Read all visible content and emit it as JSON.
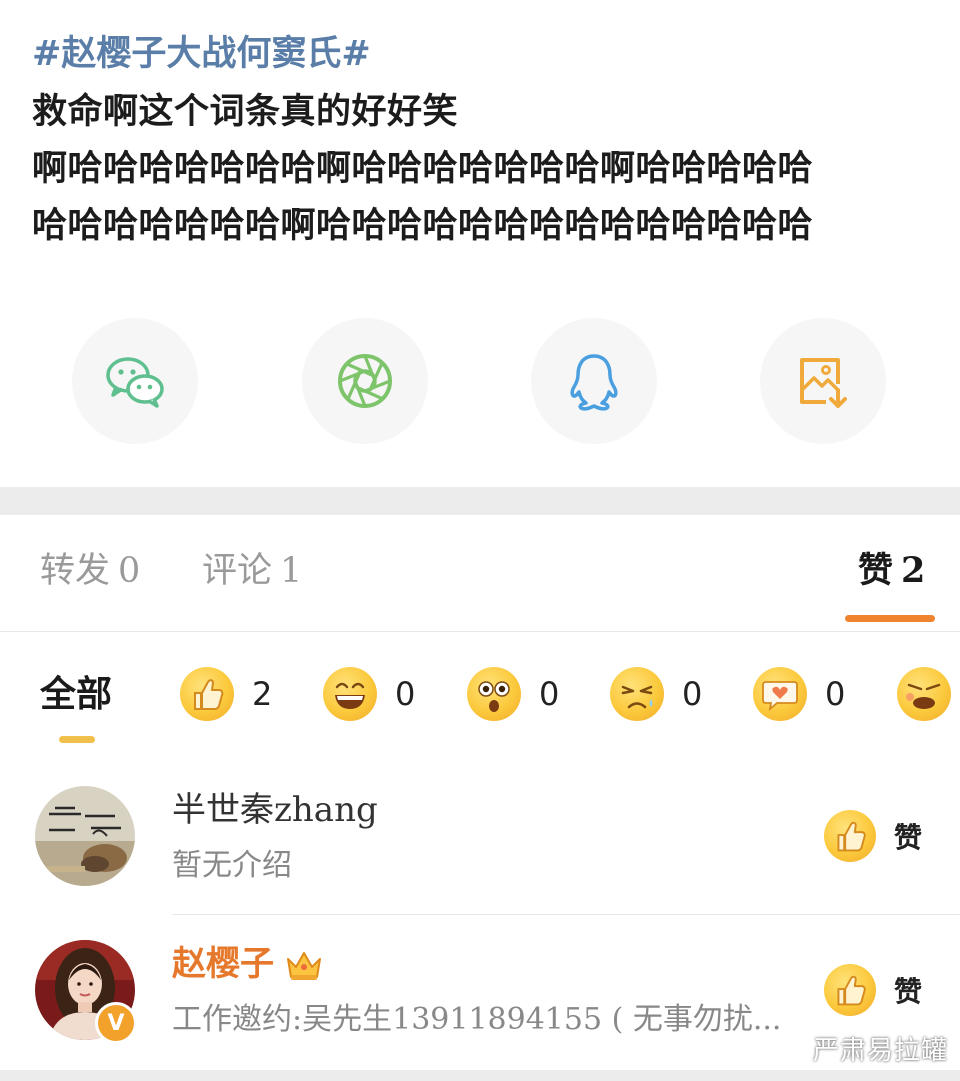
{
  "post": {
    "hashtag": "#赵樱子大战何窦氏#",
    "lines": [
      "救命啊这个词条真的好好笑",
      "啊哈哈哈哈哈哈哈啊哈哈哈哈哈哈哈啊哈哈哈哈哈",
      "哈哈哈哈哈哈哈啊哈哈哈哈哈哈哈哈哈哈哈哈哈哈"
    ]
  },
  "share": [
    {
      "icon": "wechat-icon",
      "color": "#5fbf8e"
    },
    {
      "icon": "moments-icon",
      "color": "#7dc46a"
    },
    {
      "icon": "qq-icon",
      "color": "#4a9fe0"
    },
    {
      "icon": "save-image-icon",
      "color": "#f0a93b"
    }
  ],
  "tabs": [
    {
      "label": "转发",
      "count": "0",
      "active": false
    },
    {
      "label": "评论",
      "count": "1",
      "active": false
    },
    {
      "label": "赞",
      "count": "2",
      "active": true
    }
  ],
  "reactions": {
    "all_label": "全部",
    "items": [
      {
        "icon": "thumbs-up-emoji-icon",
        "count": "2"
      },
      {
        "icon": "laugh-emoji-icon",
        "count": "0"
      },
      {
        "icon": "surprised-emoji-icon",
        "count": "0"
      },
      {
        "icon": "sad-emoji-icon",
        "count": "0"
      },
      {
        "icon": "heart-emoji-icon",
        "count": "0"
      },
      {
        "icon": "angry-emoji-icon",
        "count": ""
      }
    ]
  },
  "likers": [
    {
      "name": "半世秦zhang",
      "bio": "暂无介绍",
      "like_label": "赞",
      "avatar": "calligraphy-avatar",
      "vip": false
    },
    {
      "name": "赵樱子",
      "bio": "工作邀约:吴先生13911894155 ( 无事勿扰...",
      "like_label": "赞",
      "avatar": "portrait-avatar",
      "vip": true,
      "badge": "V"
    }
  ],
  "watermark": "严肃易拉罐",
  "colors": {
    "hashtag": "#5a7ea8",
    "accent": "#f0832e",
    "vip_name": "#e6782c"
  }
}
